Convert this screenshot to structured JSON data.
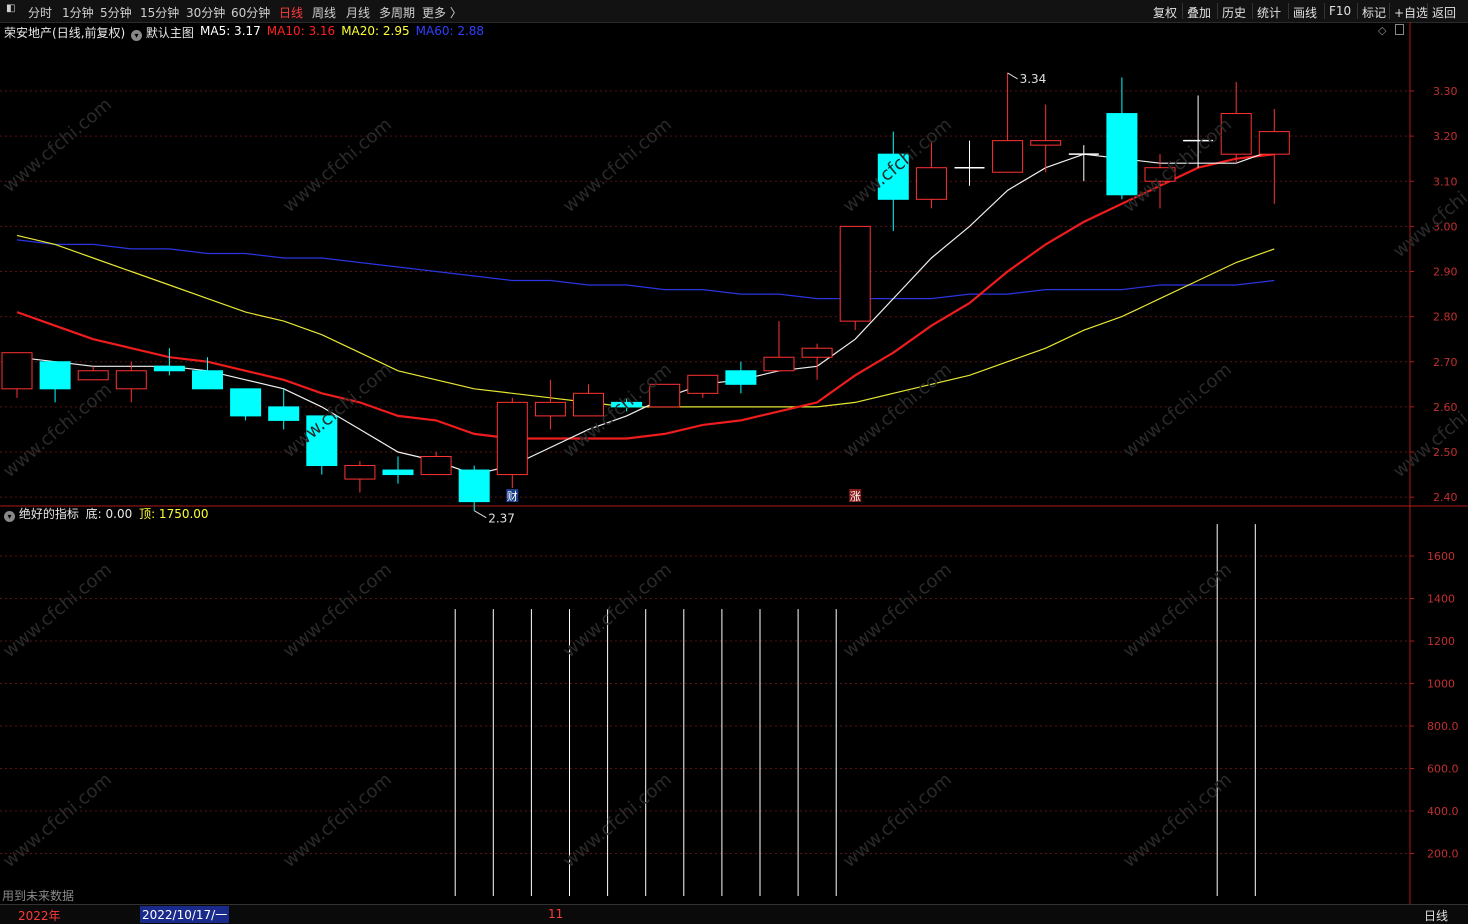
{
  "toolbar": {
    "left_items": [
      "分时",
      "1分钟",
      "5分钟",
      "15分钟",
      "30分钟",
      "60分钟",
      "日线",
      "周线",
      "月线",
      "多周期",
      "更多 〉"
    ],
    "active": "日线",
    "right_items": [
      "复权",
      "叠加",
      "历史",
      "统计",
      "画线",
      "F10",
      "标记",
      "+自选",
      "返回"
    ]
  },
  "price_panel": {
    "stock": "荣安地产",
    "mode": "(日线,前复权)",
    "template": "默认主图",
    "ma_legend": [
      {
        "label": "MA5: 3.17",
        "color": "#ffffff"
      },
      {
        "label": "MA10: 3.16",
        "color": "#ff2020"
      },
      {
        "label": "MA20: 2.95",
        "color": "#ffff33"
      },
      {
        "label": "MA60: 2.88",
        "color": "#3040ff"
      }
    ],
    "high_marker": "3.34",
    "low_marker": "2.37",
    "event_tags": [
      "财",
      "涨"
    ]
  },
  "indicator_panel": {
    "name": "绝好的指标",
    "bottom_label": "底: 0.00",
    "top_label": "顶: 1750.00",
    "footer_note": "用到未来数据"
  },
  "status": {
    "year": "2022年",
    "date": "2022/10/17/一",
    "month_mark": "11",
    "period": "日线"
  },
  "watermark": "www.cfchi.com",
  "chart_data": [
    {
      "type": "candlestick",
      "ylim": [
        2.32,
        3.36
      ],
      "y_ticks": [
        "3.30",
        "3.20",
        "3.10",
        "3.00",
        "2.90",
        "2.80",
        "2.70",
        "2.60",
        "2.50",
        "2.40"
      ],
      "candles": [
        {
          "o": 2.64,
          "h": 2.72,
          "l": 2.62,
          "c": 2.72
        },
        {
          "o": 2.7,
          "h": 2.7,
          "l": 2.61,
          "c": 2.64
        },
        {
          "o": 2.66,
          "h": 2.69,
          "l": 2.66,
          "c": 2.68
        },
        {
          "o": 2.64,
          "h": 2.7,
          "l": 2.61,
          "c": 2.68
        },
        {
          "o": 2.69,
          "h": 2.73,
          "l": 2.67,
          "c": 2.68
        },
        {
          "o": 2.68,
          "h": 2.71,
          "l": 2.64,
          "c": 2.64
        },
        {
          "o": 2.64,
          "h": 2.64,
          "l": 2.57,
          "c": 2.58
        },
        {
          "o": 2.6,
          "h": 2.64,
          "l": 2.55,
          "c": 2.57
        },
        {
          "o": 2.58,
          "h": 2.58,
          "l": 2.45,
          "c": 2.47
        },
        {
          "o": 2.44,
          "h": 2.48,
          "l": 2.41,
          "c": 2.47
        },
        {
          "o": 2.46,
          "h": 2.49,
          "l": 2.43,
          "c": 2.45
        },
        {
          "o": 2.45,
          "h": 2.5,
          "l": 2.45,
          "c": 2.49
        },
        {
          "o": 2.46,
          "h": 2.47,
          "l": 2.37,
          "c": 2.39
        },
        {
          "o": 2.45,
          "h": 2.62,
          "l": 2.42,
          "c": 2.61
        },
        {
          "o": 2.58,
          "h": 2.66,
          "l": 2.55,
          "c": 2.61
        },
        {
          "o": 2.58,
          "h": 2.65,
          "l": 2.58,
          "c": 2.63
        },
        {
          "o": 2.61,
          "h": 2.62,
          "l": 2.59,
          "c": 2.6
        },
        {
          "o": 2.6,
          "h": 2.65,
          "l": 2.6,
          "c": 2.65
        },
        {
          "o": 2.63,
          "h": 2.67,
          "l": 2.62,
          "c": 2.67
        },
        {
          "o": 2.68,
          "h": 2.7,
          "l": 2.63,
          "c": 2.65
        },
        {
          "o": 2.68,
          "h": 2.79,
          "l": 2.68,
          "c": 2.71
        },
        {
          "o": 2.71,
          "h": 2.74,
          "l": 2.66,
          "c": 2.73
        },
        {
          "o": 2.79,
          "h": 3.0,
          "l": 2.77,
          "c": 3.0
        },
        {
          "o": 3.16,
          "h": 3.21,
          "l": 2.99,
          "c": 3.06
        },
        {
          "o": 3.06,
          "h": 3.19,
          "l": 3.04,
          "c": 3.13
        },
        {
          "o": 3.13,
          "h": 3.19,
          "l": 3.09,
          "c": 3.13
        },
        {
          "o": 3.12,
          "h": 3.34,
          "l": 3.12,
          "c": 3.19
        },
        {
          "o": 3.18,
          "h": 3.27,
          "l": 3.12,
          "c": 3.19
        },
        {
          "o": 3.16,
          "h": 3.18,
          "l": 3.1,
          "c": 3.16
        },
        {
          "o": 3.25,
          "h": 3.33,
          "l": 3.06,
          "c": 3.07
        },
        {
          "o": 3.1,
          "h": 3.16,
          "l": 3.04,
          "c": 3.13
        },
        {
          "o": 3.19,
          "h": 3.29,
          "l": 3.13,
          "c": 3.19
        },
        {
          "o": 3.16,
          "h": 3.32,
          "l": 3.14,
          "c": 3.25
        },
        {
          "o": 3.16,
          "h": 3.26,
          "l": 3.05,
          "c": 3.21
        }
      ],
      "ma5": [
        2.71,
        2.7,
        2.69,
        2.69,
        2.69,
        2.68,
        2.66,
        2.64,
        2.6,
        2.55,
        2.5,
        2.48,
        2.45,
        2.47,
        2.51,
        2.55,
        2.58,
        2.62,
        2.65,
        2.66,
        2.68,
        2.69,
        2.75,
        2.84,
        2.93,
        3.0,
        3.08,
        3.13,
        3.16,
        3.15,
        3.14,
        3.14,
        3.14,
        3.17
      ],
      "ma10": [
        2.81,
        2.78,
        2.75,
        2.73,
        2.71,
        2.7,
        2.68,
        2.66,
        2.63,
        2.61,
        2.58,
        2.57,
        2.54,
        2.53,
        2.53,
        2.53,
        2.53,
        2.54,
        2.56,
        2.57,
        2.59,
        2.61,
        2.67,
        2.72,
        2.78,
        2.83,
        2.9,
        2.96,
        3.01,
        3.05,
        3.09,
        3.13,
        3.15,
        3.16
      ],
      "ma20": [
        2.98,
        2.96,
        2.93,
        2.9,
        2.87,
        2.84,
        2.81,
        2.79,
        2.76,
        2.72,
        2.68,
        2.66,
        2.64,
        2.63,
        2.62,
        2.61,
        2.6,
        2.6,
        2.6,
        2.6,
        2.6,
        2.6,
        2.61,
        2.63,
        2.65,
        2.67,
        2.7,
        2.73,
        2.77,
        2.8,
        2.84,
        2.88,
        2.92,
        2.95
      ],
      "ma60": [
        2.97,
        2.96,
        2.96,
        2.95,
        2.95,
        2.94,
        2.94,
        2.93,
        2.93,
        2.92,
        2.91,
        2.9,
        2.89,
        2.88,
        2.88,
        2.87,
        2.87,
        2.86,
        2.86,
        2.85,
        2.85,
        2.84,
        2.84,
        2.84,
        2.84,
        2.85,
        2.85,
        2.86,
        2.86,
        2.86,
        2.87,
        2.87,
        2.87,
        2.88
      ]
    },
    {
      "type": "bar",
      "ylim": [
        0,
        1750
      ],
      "y_ticks": [
        "1600",
        "1400",
        "1200",
        "1000",
        "800.0",
        "600.0",
        "400.0",
        "200.0"
      ],
      "values": [
        0,
        0,
        0,
        0,
        0,
        0,
        0,
        0,
        0,
        0,
        0,
        0,
        1350,
        1350,
        1350,
        1350,
        1350,
        1350,
        1350,
        1350,
        1350,
        1350,
        1350,
        0,
        0,
        0,
        0,
        0,
        0,
        0,
        0,
        0,
        1750,
        1750
      ]
    }
  ]
}
